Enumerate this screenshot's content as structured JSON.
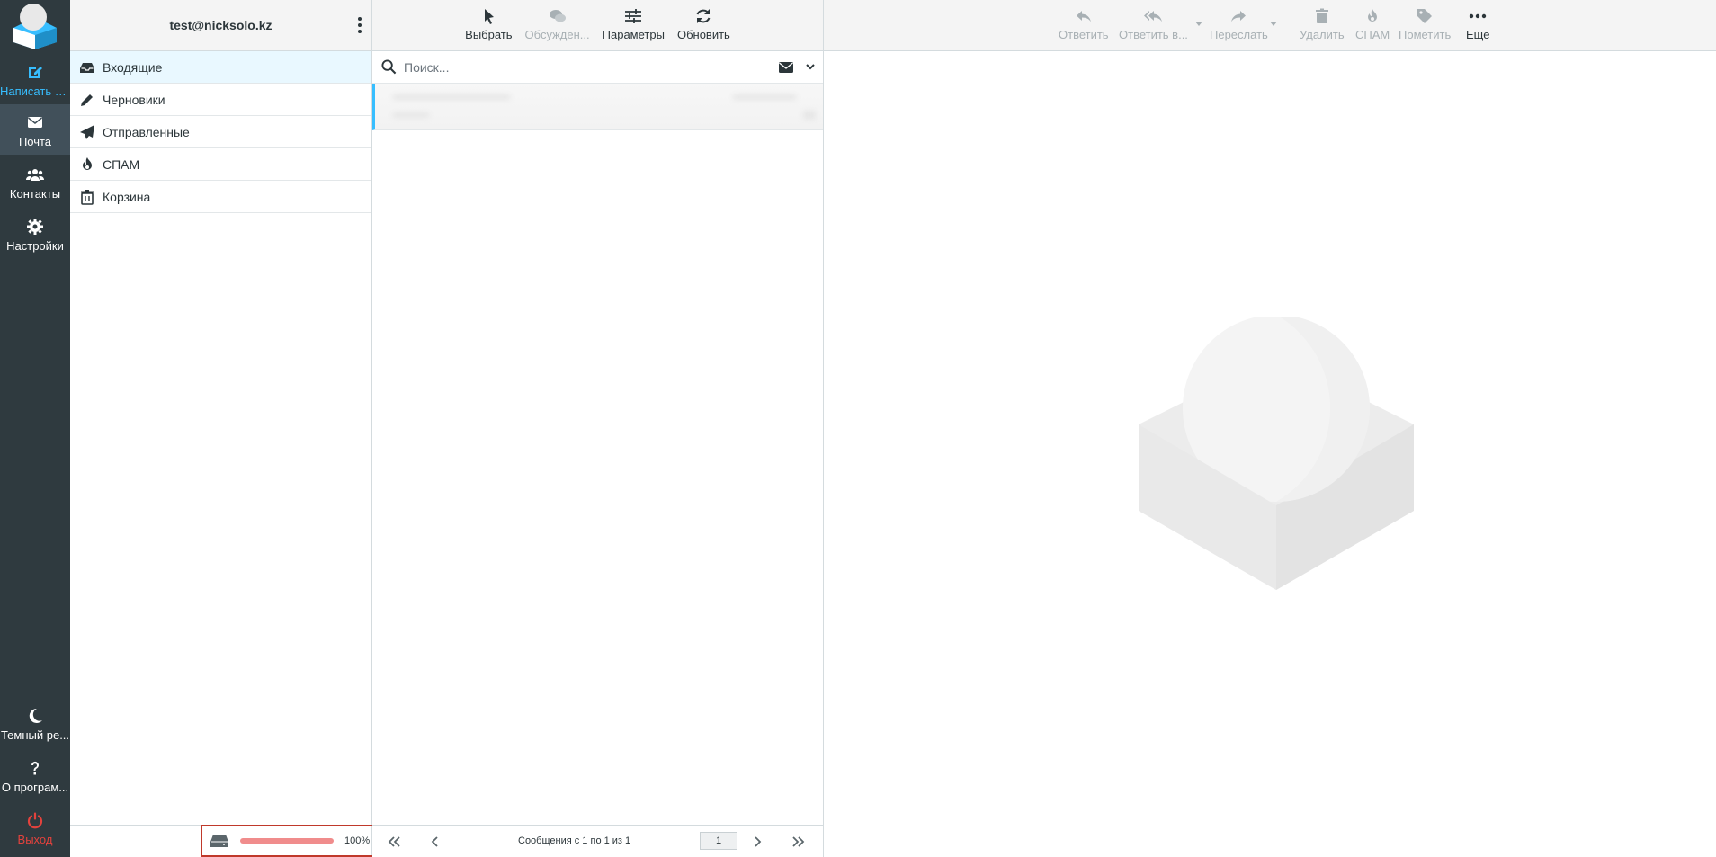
{
  "taskmenu": {
    "compose": "Написать с...",
    "mail": "Почта",
    "contacts": "Контакты",
    "settings": "Настройки",
    "dark_mode": "Темный ре...",
    "about": "О програм...",
    "logout": "Выход"
  },
  "account": {
    "email": "test@nicksolo.kz"
  },
  "folders": [
    {
      "label": "Входящие",
      "icon": "inbox-icon",
      "selected": true
    },
    {
      "label": "Черновики",
      "icon": "pencil-icon",
      "selected": false
    },
    {
      "label": "Отправленные",
      "icon": "paper-plane-icon",
      "selected": false
    },
    {
      "label": "СПАМ",
      "icon": "fire-icon",
      "selected": false
    },
    {
      "label": "Корзина",
      "icon": "trash-icon",
      "selected": false
    }
  ],
  "quota": {
    "percent_label": "100%",
    "fraction": 1.0
  },
  "list_toolbar": {
    "select": "Выбрать",
    "threads": "Обсужден...",
    "options": "Параметры",
    "refresh": "Обновить"
  },
  "search": {
    "placeholder": "Поиск..."
  },
  "pager": {
    "count": "Сообщения с 1 по 1 из 1",
    "page": "1"
  },
  "message_toolbar": {
    "reply": "Ответить",
    "reply_all": "Ответить в...",
    "forward": "Переслать",
    "delete": "Удалить",
    "spam": "СПАМ",
    "mark": "Пометить",
    "more": "Еще"
  },
  "colors": {
    "accent": "#37beff",
    "danger": "#e3423d",
    "sidebar": "#2f3a3f"
  }
}
